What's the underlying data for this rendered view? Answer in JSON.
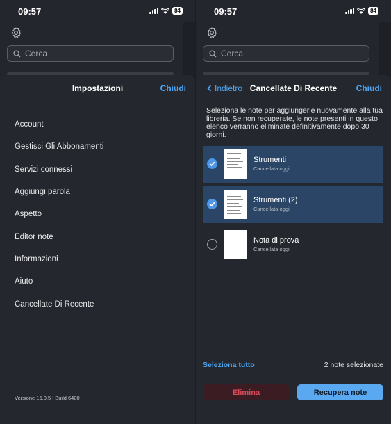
{
  "status_bar": {
    "time": "09:57",
    "battery": "84"
  },
  "background": {
    "search_placeholder": "Cerca"
  },
  "settings": {
    "title": "Impostazioni",
    "close_label": "Chiudi",
    "items": [
      {
        "label": "Account"
      },
      {
        "label": "Gestisci Gli Abbonamenti"
      },
      {
        "label": "Servizi connessi"
      },
      {
        "label": "Aggiungi parola"
      },
      {
        "label": "Aspetto"
      },
      {
        "label": "Editor note"
      },
      {
        "label": "Informazioni"
      },
      {
        "label": "Aiuto"
      },
      {
        "label": "Cancellate Di Recente"
      }
    ],
    "version": "Versione 15.0.5 | Build 6400"
  },
  "recently_deleted": {
    "back_label": "Indietro",
    "title": "Cancellate Di Recente",
    "close_label": "Chiudi",
    "description": "Seleziona le note per aggiungerle nuovamente alla tua libreria. Se non recuperate, le note presenti in questo elenco verranno eliminate definitivamente dopo 30 giorni.",
    "notes": [
      {
        "title": "Strumenti",
        "subtitle": "Cancellata oggi",
        "selected": true
      },
      {
        "title": "Strumenti (2)",
        "subtitle": "Cancellata oggi",
        "selected": true
      },
      {
        "title": "Nota di prova",
        "subtitle": "Cancellata oggi",
        "selected": false
      }
    ],
    "select_all_label": "Seleziona tutto",
    "selection_count": "2 note selezionate",
    "delete_label": "Elimina",
    "recover_label": "Recupera note"
  },
  "colors": {
    "accent": "#4fa4f0",
    "selected_row": "#2a4566",
    "delete_text": "#d94a5a",
    "recover_bg": "#5aa8f0"
  }
}
